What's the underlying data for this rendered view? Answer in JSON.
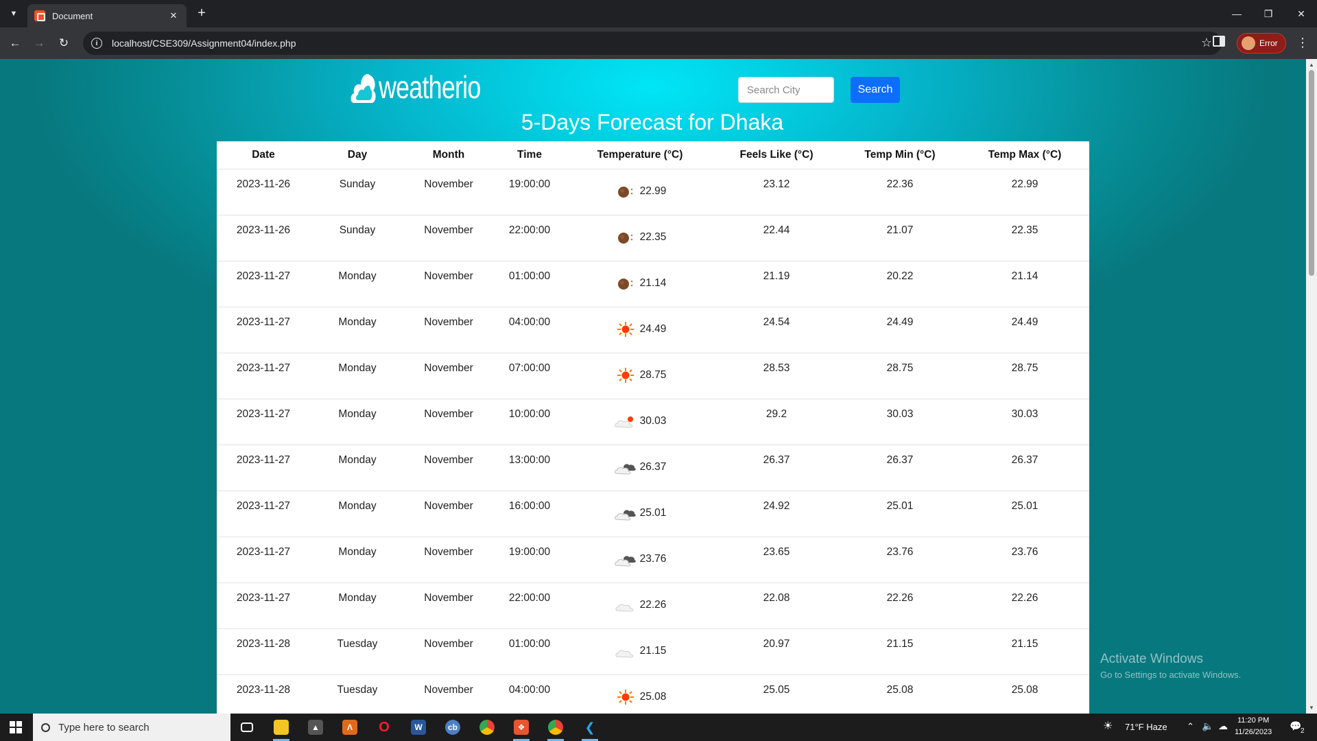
{
  "browser": {
    "tab_title": "Document",
    "url": "localhost/CSE309/Assignment04/index.php",
    "profile_label": "Error"
  },
  "page": {
    "logo_text": "weatherio",
    "search": {
      "placeholder": "Search City",
      "button_label": "Search"
    },
    "title": "5-Days Forecast for Dhaka",
    "table": {
      "headers": [
        "Date",
        "Day",
        "Month",
        "Time",
        "Temperature (°C)",
        "Feels Like (°C)",
        "Temp Min (°C)",
        "Temp Max (°C)"
      ],
      "rows": [
        {
          "date": "2023-11-26",
          "day": "Sunday",
          "month": "November",
          "time": "19:00:00",
          "icon": "night-moon-icon",
          "temp": "22.99",
          "feels": "23.12",
          "min": "22.36",
          "max": "22.99"
        },
        {
          "date": "2023-11-26",
          "day": "Sunday",
          "month": "November",
          "time": "22:00:00",
          "icon": "night-moon-icon",
          "temp": "22.35",
          "feels": "22.44",
          "min": "21.07",
          "max": "22.35"
        },
        {
          "date": "2023-11-27",
          "day": "Monday",
          "month": "November",
          "time": "01:00:00",
          "icon": "night-moon-icon",
          "temp": "21.14",
          "feels": "21.19",
          "min": "20.22",
          "max": "21.14"
        },
        {
          "date": "2023-11-27",
          "day": "Monday",
          "month": "November",
          "time": "04:00:00",
          "icon": "sun-icon",
          "temp": "24.49",
          "feels": "24.54",
          "min": "24.49",
          "max": "24.49"
        },
        {
          "date": "2023-11-27",
          "day": "Monday",
          "month": "November",
          "time": "07:00:00",
          "icon": "sun-icon",
          "temp": "28.75",
          "feels": "28.53",
          "min": "28.75",
          "max": "28.75"
        },
        {
          "date": "2023-11-27",
          "day": "Monday",
          "month": "November",
          "time": "10:00:00",
          "icon": "partly-cloudy-icon",
          "temp": "30.03",
          "feels": "29.2",
          "min": "30.03",
          "max": "30.03"
        },
        {
          "date": "2023-11-27",
          "day": "Monday",
          "month": "November",
          "time": "13:00:00",
          "icon": "broken-clouds-icon",
          "temp": "26.37",
          "feels": "26.37",
          "min": "26.37",
          "max": "26.37"
        },
        {
          "date": "2023-11-27",
          "day": "Monday",
          "month": "November",
          "time": "16:00:00",
          "icon": "broken-clouds-icon",
          "temp": "25.01",
          "feels": "24.92",
          "min": "25.01",
          "max": "25.01"
        },
        {
          "date": "2023-11-27",
          "day": "Monday",
          "month": "November",
          "time": "19:00:00",
          "icon": "broken-clouds-icon",
          "temp": "23.76",
          "feels": "23.65",
          "min": "23.76",
          "max": "23.76"
        },
        {
          "date": "2023-11-27",
          "day": "Monday",
          "month": "November",
          "time": "22:00:00",
          "icon": "cloud-icon",
          "temp": "22.26",
          "feels": "22.08",
          "min": "22.26",
          "max": "22.26"
        },
        {
          "date": "2023-11-28",
          "day": "Tuesday",
          "month": "November",
          "time": "01:00:00",
          "icon": "cloud-icon",
          "temp": "21.15",
          "feels": "20.97",
          "min": "21.15",
          "max": "21.15"
        },
        {
          "date": "2023-11-28",
          "day": "Tuesday",
          "month": "November",
          "time": "04:00:00",
          "icon": "sun-icon",
          "temp": "25.08",
          "feels": "25.05",
          "min": "25.08",
          "max": "25.08"
        }
      ]
    }
  },
  "watermark": {
    "title": "Activate Windows",
    "subtitle": "Go to Settings to activate Windows."
  },
  "taskbar": {
    "search_placeholder": "Type here to search",
    "weather": "71°F  Haze",
    "time": "11:20 PM",
    "date": "11/26/2023",
    "notification_count": "2"
  },
  "colors": {
    "accent": "#0d6efd",
    "page_bg_center": "#00e6f7",
    "page_bg_edge": "#07787e"
  }
}
